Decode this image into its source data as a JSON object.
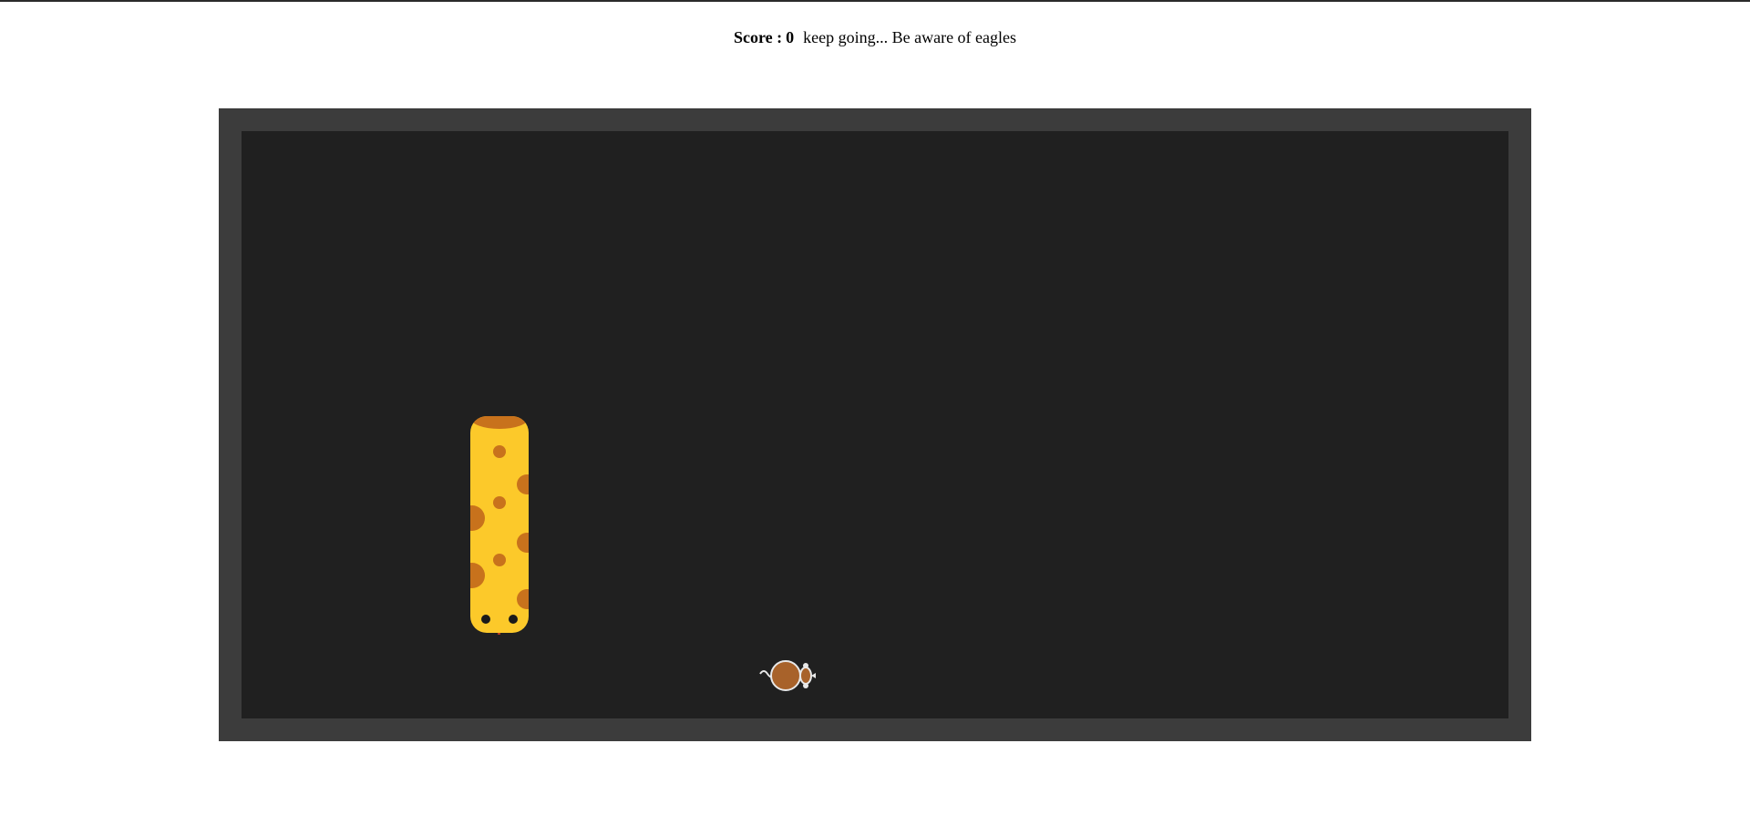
{
  "header": {
    "score_label": "Score :",
    "score_value": "0",
    "message": "keep going... Be aware of eagles"
  },
  "board": {
    "frame_color": "#3c3c3c",
    "field_color": "#202020"
  },
  "snake": {
    "body_color": "#fcc92a",
    "spot_color": "#c8721c",
    "tongue_color": "#b03a20",
    "eye_color": "#1a1a1a"
  },
  "mouse": {
    "body_color": "#a8622a",
    "outline_color": "#e8e8e8"
  }
}
